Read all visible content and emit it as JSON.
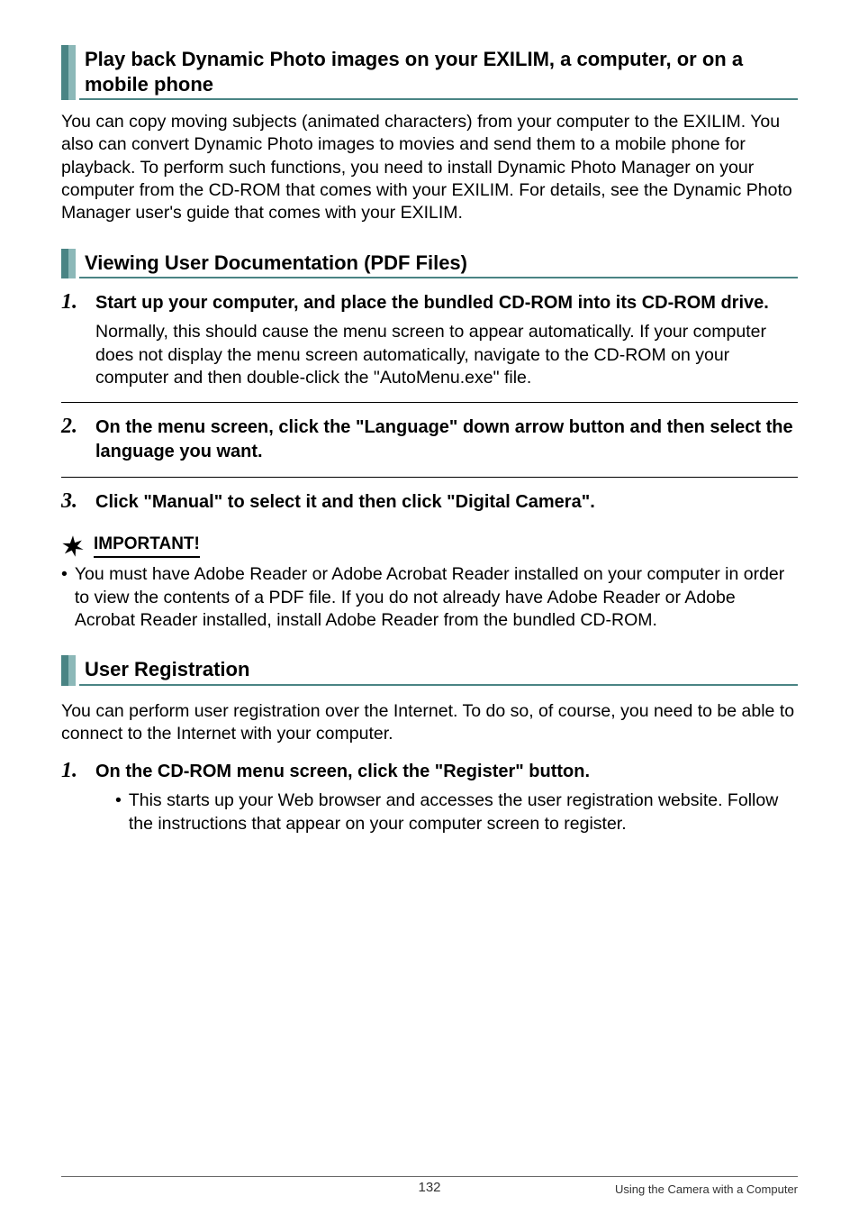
{
  "sections": {
    "s1": {
      "title": "Play back Dynamic Photo images on your EXILIM, a computer, or on a mobile phone",
      "body": "You can copy moving subjects (animated characters) from your computer to the EXILIM. You also can convert Dynamic Photo images to movies and send them to a mobile phone for playback. To perform such functions, you need to install Dynamic Photo Manager on your computer from the CD-ROM that comes with your EXILIM. For details, see the Dynamic Photo Manager user's guide that comes with your EXILIM."
    },
    "s2": {
      "title": "Viewing User Documentation (PDF Files)"
    },
    "s3": {
      "title": "User Registration",
      "body": "You can perform user registration over the Internet. To do so, of course, you need to be able to connect to the Internet with your computer."
    }
  },
  "steps": {
    "st1": {
      "num": "1.",
      "title": "Start up your computer, and place the bundled CD-ROM into its CD-ROM drive.",
      "body": "Normally, this should cause the menu screen to appear automatically. If your computer does not display the menu screen automatically, navigate to the CD-ROM on your computer and then double-click the \"AutoMenu.exe\" file."
    },
    "st2": {
      "num": "2.",
      "title": "On the menu screen, click the \"Language\" down arrow button and then select the language you want."
    },
    "st3": {
      "num": "3.",
      "title": "Click \"Manual\" to select it and then click \"Digital Camera\"."
    },
    "st4": {
      "num": "1.",
      "title": "On the CD-ROM menu screen, click the \"Register\" button.",
      "sub": "This starts up your Web browser and accesses the user registration website. Follow the instructions that appear on your computer screen to register."
    }
  },
  "important": {
    "label": "IMPORTANT!",
    "bullet": "You must have Adobe Reader or Adobe Acrobat Reader installed on your computer in order to view the contents of a PDF file. If you do not already have Adobe Reader or Adobe Acrobat Reader installed, install Adobe Reader from the bundled CD-ROM."
  },
  "footer": {
    "page": "132",
    "right": "Using the Camera with a Computer"
  },
  "glyphs": {
    "bullet": "•"
  }
}
